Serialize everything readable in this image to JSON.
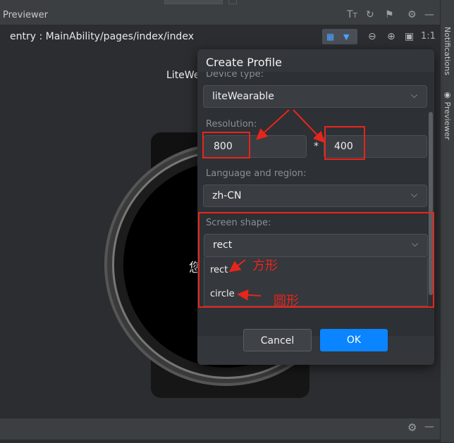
{
  "panel": {
    "title": "Previewer",
    "path": "entry : MainAbility/pages/index/index"
  },
  "icons": {
    "font_size": "font-icon",
    "refresh": "sync-icon",
    "pin": "pin-icon",
    "settings": "gear-icon",
    "minimize": "minimize-icon",
    "device_toggle": "grid-icon",
    "dropdown": "triangle-down-icon",
    "zoom_out": "zoom-out-icon",
    "zoom_in": "zoom-in-icon",
    "fit": "fit-screen-icon",
    "actual_size": "actual-size-icon"
  },
  "toolbar": {
    "actual_size_label": "1:1"
  },
  "side_tabs": {
    "notifications": "Notifications",
    "previewer": "Previewer"
  },
  "device": {
    "label": "LiteWe",
    "watch_text": "您"
  },
  "dialog": {
    "title": "Create Profile",
    "device_type_label": "Device type:",
    "device_type_value": "liteWearable",
    "resolution_label": "Resolution:",
    "width_value": "800",
    "separator": "*",
    "height_value": "400",
    "language_label": "Language and region:",
    "language_value": "zh-CN",
    "shape_label": "Screen shape:",
    "shape_value": "rect",
    "shape_options": [
      "rect",
      "circle"
    ],
    "cancel_label": "Cancel",
    "ok_label": "OK"
  },
  "annotations": {
    "rect_note": "方形",
    "circle_note": "圆形"
  },
  "colors": {
    "accent": "#0a84ff",
    "annotation": "#e8251c"
  }
}
